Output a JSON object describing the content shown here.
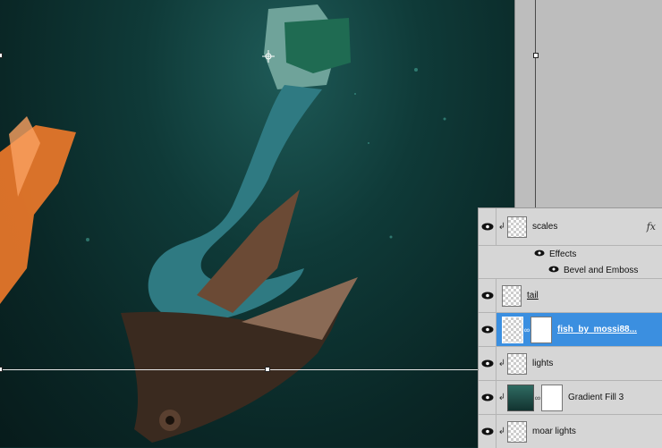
{
  "layers_panel": {
    "layers": [
      {
        "name": "scales",
        "fx": "fx",
        "effects_label": "Effects",
        "effect_items": [
          "Bevel and Emboss"
        ]
      },
      {
        "name": "tail"
      },
      {
        "name": "fish_by_mossi88..."
      },
      {
        "name": "lights"
      },
      {
        "name": "Gradient Fill 3"
      },
      {
        "name": "moar lights"
      }
    ]
  },
  "colors": {
    "selected": "#3b8fe0",
    "panel": "#d6d6d6",
    "water": "#0f3a38"
  },
  "icons": [
    "eye-icon",
    "clip-arrow-icon",
    "link-chain-icon",
    "fx-icon"
  ]
}
